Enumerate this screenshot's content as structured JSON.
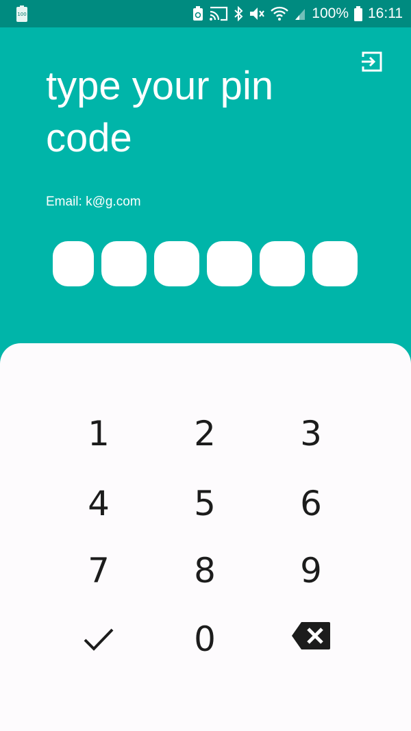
{
  "status_bar": {
    "battery_small_label": "100",
    "battery_percent": "100%",
    "time": "16:11",
    "icons": [
      "recycle-battery-icon",
      "cast-icon",
      "bluetooth-icon",
      "mute-icon",
      "wifi-icon",
      "signal-icon",
      "battery-icon"
    ]
  },
  "header": {
    "title": "type your pin code",
    "email_line": "Email: k@g.com",
    "logout_icon": "exit-icon"
  },
  "pin": {
    "length": 6,
    "filled": 0
  },
  "keypad": {
    "keys": [
      "1",
      "2",
      "3",
      "4",
      "5",
      "6",
      "7",
      "8",
      "9",
      "0"
    ],
    "confirm_icon": "checkmark-icon",
    "delete_icon": "backspace-icon"
  },
  "colors": {
    "header_bg": "#00b5a9",
    "status_bar_bg": "#008b80",
    "keypad_bg": "#fdfbfd",
    "key_text": "#1c1c1c"
  }
}
